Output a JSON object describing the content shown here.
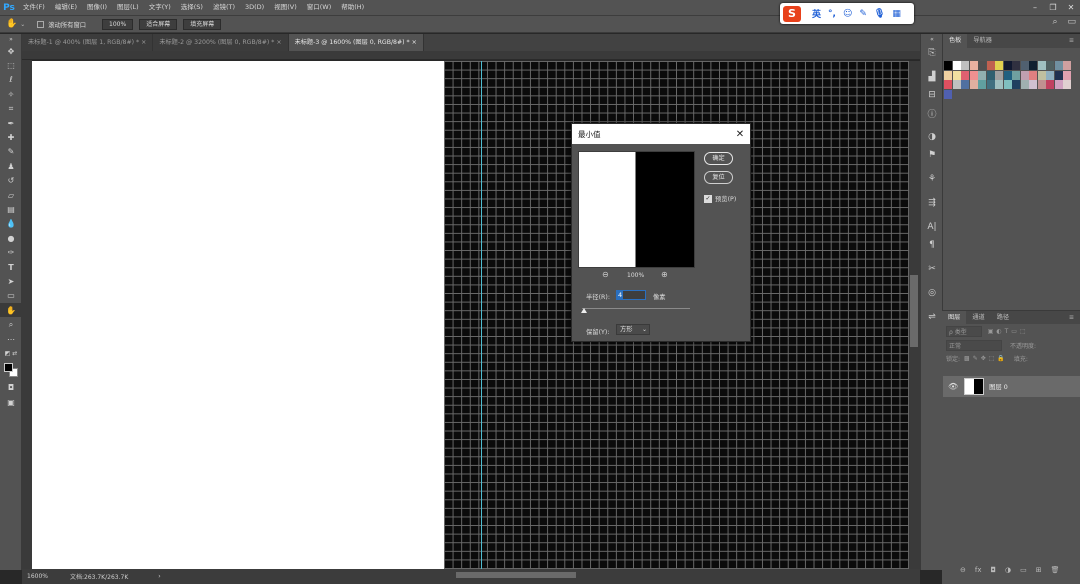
{
  "app": {
    "logo": "Ps"
  },
  "menu": [
    "文件(F)",
    "编辑(E)",
    "图像(I)",
    "图层(L)",
    "文字(Y)",
    "选择(S)",
    "滤镜(T)",
    "3D(D)",
    "视图(V)",
    "窗口(W)",
    "帮助(H)"
  ],
  "options": {
    "tool_icon": "hand-icon",
    "checkbox_label": "滚动所有窗口",
    "zoom_button": "100%",
    "fit_button": "适合屏幕",
    "fill_button": "填充屏幕"
  },
  "ime": {
    "logo": "S",
    "lang": "英"
  },
  "tabs": [
    {
      "label": "未标题-1 @ 400% (图层 1, RGB/8#) *",
      "close": "×"
    },
    {
      "label": "未标题-2 @ 3200% (图层 0, RGB/8#) *",
      "close": "×"
    },
    {
      "label": "未标题-3 @ 1600% (图层 0, RGB/8#) *",
      "close": "×"
    }
  ],
  "status": {
    "zoom": "1600%",
    "doc": "文档:263.7K/263.7K",
    "arrow": "›"
  },
  "panels": {
    "top_tabs": [
      "色板",
      "导航器"
    ],
    "layers_tabs": [
      "图层",
      "通道",
      "路径"
    ],
    "kind_label": "ρ 类型",
    "blend_mode": "正常",
    "opacity_label": "不透明度:",
    "lock_label": "锁定:",
    "fill_label": "填充:",
    "layer_name": "图层 0"
  },
  "swatch_colors": [
    "#000000",
    "#ffffff",
    "#c0c0c0",
    "#e8b0a0",
    "#505050",
    "#c06050",
    "#e0d050",
    "#101830",
    "#303040",
    "#506070",
    "#102030",
    "#a0c0c0",
    "#506060",
    "#7090a0",
    "#d0a0a0",
    "#f0d0a0",
    "#f0e0a0",
    "#e06070",
    "#f09090",
    "#90b0b0",
    "#306070",
    "#a0a0a0",
    "#206080",
    "#70a0a0",
    "#c0a0b0",
    "#e08080",
    "#c0c0a0",
    "#90b0c0",
    "#203050",
    "#e0a0b0",
    "#e05060",
    "#c0c0c0",
    "#5070a0",
    "#e0b0a0",
    "#60a0a0",
    "#407080",
    "#a0c0c0",
    "#80c0c0",
    "#204060",
    "#a0b0b0",
    "#d0c0d0",
    "#c09090",
    "#c04060",
    "#d0a0c0",
    "#e0d0d0",
    "#5060b0"
  ],
  "dialog": {
    "title": "最小值",
    "ok": "确定",
    "reset": "复位",
    "preview_label": "预览(P)",
    "zoom_value": "100%",
    "radius_label": "半径(R):",
    "radius_value": "4",
    "radius_unit": "像素",
    "preserve_label": "保留(Y):",
    "preserve_value": "方形"
  }
}
